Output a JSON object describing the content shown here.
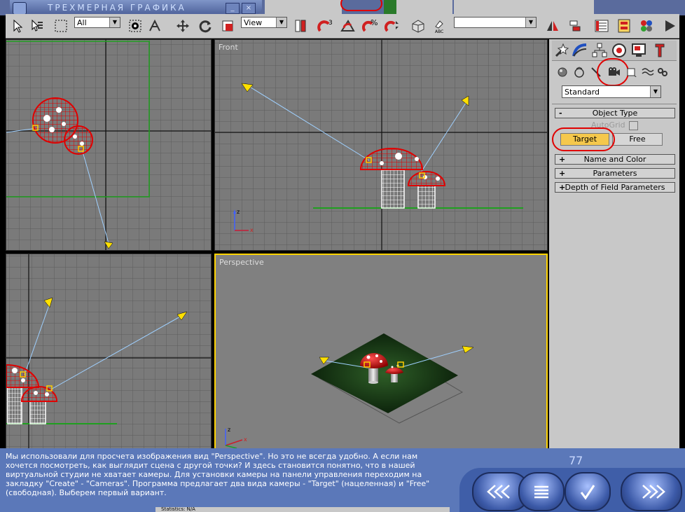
{
  "window": {
    "title": "ТРЕХМЕРНАЯ ГРАФИКА"
  },
  "toolbar": {
    "selection_filter": "All",
    "coord_system": "View"
  },
  "viewports": {
    "front_label": "Front",
    "perspective_label": "Perspective"
  },
  "command_panel": {
    "category_dropdown": "Standard",
    "rollouts": {
      "object_type": {
        "sign": "-",
        "label": "Object Type"
      },
      "autogrid_label": "AutoGrid",
      "target_button": "Target",
      "free_button": "Free",
      "name_and_color": {
        "sign": "+",
        "label": "Name and Color"
      },
      "parameters": {
        "sign": "+",
        "label": "Parameters"
      },
      "depth_of_field": {
        "sign": "+",
        "label": "Depth of Field Parameters"
      }
    }
  },
  "info": {
    "text": "Мы использовали для просчета изображения вид \"Perspective\". Но это не всегда удобно. А если нам хочется посмотреть, как выглядит сцена с другой точки? И здесь становится понятно, что в нашей виртуальной студии не хватает камеры. Для установки камеры на панели управления переходим на закладку \"Create\" - \"Cameras\". Программа предлагает два вида камеры - \"Target\" (нацеленная) и \"Free\" (свободная). Выберем первый вариант.",
    "page_number": "77",
    "status_text": "Statistics: N/A"
  },
  "colors": {
    "highlight": "#e00000",
    "selected_button": "#f5c84c",
    "viewport_bg": "#7a7a7a",
    "active_viewport_border": "#ffd400"
  }
}
